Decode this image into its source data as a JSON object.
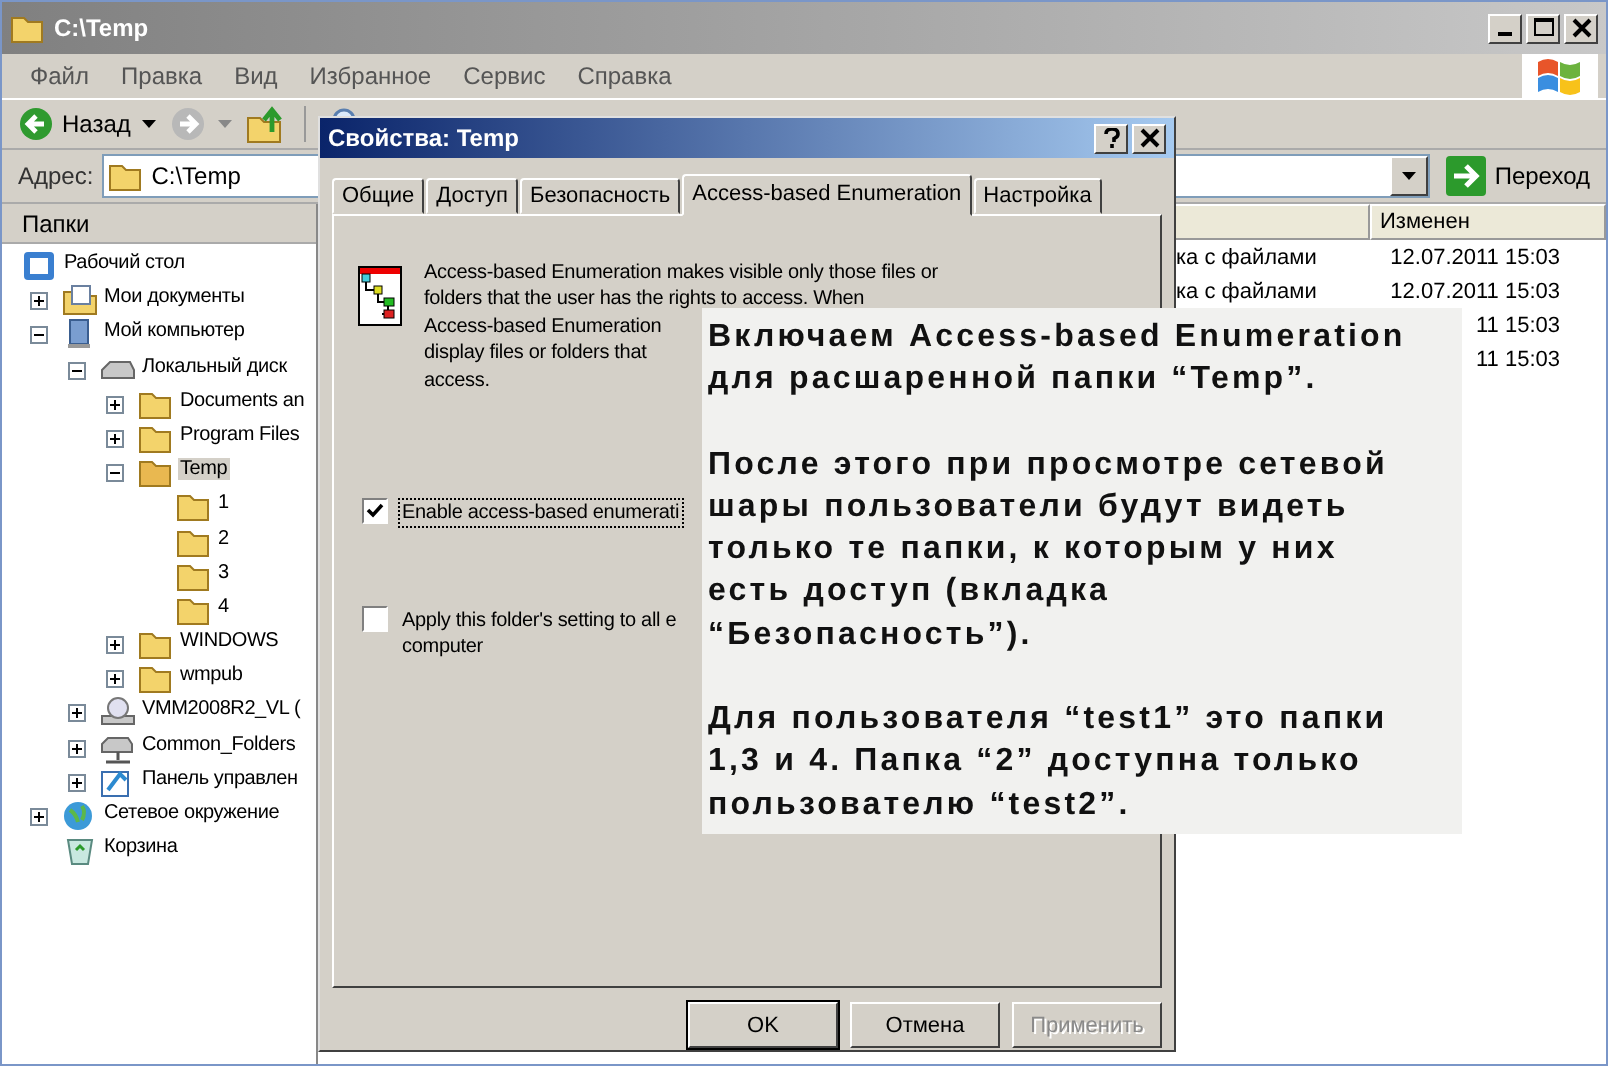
{
  "window": {
    "title": "C:\\Temp"
  },
  "menu": [
    "Файл",
    "Правка",
    "Вид",
    "Избранное",
    "Сервис",
    "Справка"
  ],
  "toolbar": {
    "back": "Назад"
  },
  "address": {
    "label": "Адрес:",
    "value": "C:\\Temp",
    "go": "Переход"
  },
  "folders": {
    "title": "Папки",
    "tree": [
      {
        "label": "Рабочий стол",
        "kind": "desktop",
        "selected": false,
        "children": [
          {
            "label": "Мои документы",
            "kind": "documents",
            "expanded": false,
            "selected": false
          },
          {
            "label": "Мой компьютер",
            "kind": "computer",
            "expanded": true,
            "selected": false,
            "children": [
              {
                "label": "Локальный диск",
                "kind": "drive",
                "expanded": true,
                "selected": false,
                "children": [
                  {
                    "label": "Documents an",
                    "kind": "folder",
                    "expanded": false,
                    "selected": false
                  },
                  {
                    "label": "Program Files",
                    "kind": "folder",
                    "expanded": false,
                    "selected": false
                  },
                  {
                    "label": "Temp",
                    "kind": "folder",
                    "expanded": true,
                    "selected": true,
                    "children": [
                      {
                        "label": "1",
                        "kind": "folder",
                        "selected": false
                      },
                      {
                        "label": "2",
                        "kind": "folder",
                        "selected": false
                      },
                      {
                        "label": "3",
                        "kind": "folder",
                        "selected": false
                      },
                      {
                        "label": "4",
                        "kind": "folder",
                        "selected": false
                      }
                    ]
                  },
                  {
                    "label": "WINDOWS",
                    "kind": "folder",
                    "expanded": false,
                    "selected": false
                  },
                  {
                    "label": "wmpub",
                    "kind": "folder",
                    "expanded": false,
                    "selected": false
                  }
                ]
              },
              {
                "label": "VMM2008R2_VL (",
                "kind": "cdrom",
                "expanded": false,
                "selected": false
              },
              {
                "label": "Common_Folders",
                "kind": "network-drive",
                "expanded": false,
                "selected": false
              },
              {
                "label": "Панель управлен",
                "kind": "control-panel",
                "expanded": false,
                "selected": false
              }
            ]
          },
          {
            "label": "Сетевое окружение",
            "kind": "network",
            "expanded": false,
            "selected": false
          },
          {
            "label": "Корзина",
            "kind": "recycle",
            "selected": false
          }
        ]
      }
    ]
  },
  "list": {
    "columns": [
      "Изменен"
    ],
    "rows": [
      {
        "type": "ка с файлами",
        "modified": "12.07.2011 15:03"
      },
      {
        "type": "ка с файлами",
        "modified": "12.07.2011 15:03"
      },
      {
        "modified": "11 15:03"
      },
      {
        "modified": "11 15:03"
      }
    ]
  },
  "dialog": {
    "title": "Свойства: Temp",
    "tabs": [
      {
        "label": "Общие",
        "selected": false
      },
      {
        "label": "Доступ",
        "selected": false
      },
      {
        "label": "Безопасность",
        "selected": false
      },
      {
        "label": "Access-based Enumeration",
        "selected": true
      },
      {
        "label": "Настройка",
        "selected": false
      }
    ],
    "description": [
      "Access-based Enumeration makes visible only those files or",
      "folders that the user has the rights to access. When",
      "Access-based Enumeration",
      "display files or folders that",
      "access."
    ],
    "checkboxes": [
      {
        "label": "Enable access-based enumerati",
        "checked": true,
        "focused": true
      },
      {
        "label": "Apply this folder's setting to all e\ncomputer",
        "checked": false,
        "focused": false
      }
    ],
    "buttons": [
      {
        "label": "OK",
        "disabled": false
      },
      {
        "label": "Отмена",
        "disabled": false
      },
      {
        "label": "Применить",
        "disabled": true
      }
    ]
  },
  "note": {
    "paragraphs": [
      "Включаем Access-based Enumeration\nдля расшаренной папки “Temp”.",
      "После этого при просмотре сетевой\nшары пользователи будут видеть\nтолько те папки, к которым у них\nесть доступ (вкладка\n“Безопасность”).",
      "Для пользователя “test1” это папки\n1,3 и 4. Папка “2” доступна только\nпользователю “test2”."
    ]
  }
}
